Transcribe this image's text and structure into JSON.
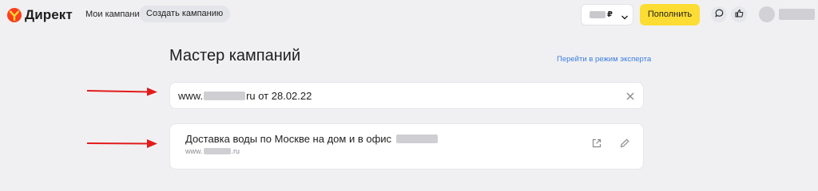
{
  "header": {
    "logo_text": "Директ",
    "nav": {
      "my_campaigns": "Мои кампании",
      "create_campaign": "Создать кампанию"
    },
    "balance": {
      "currency_symbol": "₽"
    },
    "topup_label": "Пополнить",
    "icons": [
      "chat-bubble-icon",
      "thumbs-up-icon"
    ]
  },
  "main": {
    "title": "Мастер кампаний",
    "expert_link": "Перейти в режим эксперта",
    "search": {
      "value_prefix": "www.",
      "value_suffix": "ru от 28.02.22"
    },
    "campaign": {
      "title": "Доставка воды по Москве на дом и в офис",
      "url_prefix": "www.",
      "url_suffix": ".ru"
    }
  },
  "colors": {
    "background": "#f0f0f2",
    "accent_yellow": "#fddc33",
    "link_blue": "#3b7de0",
    "arrow_red": "#e21b1b"
  }
}
